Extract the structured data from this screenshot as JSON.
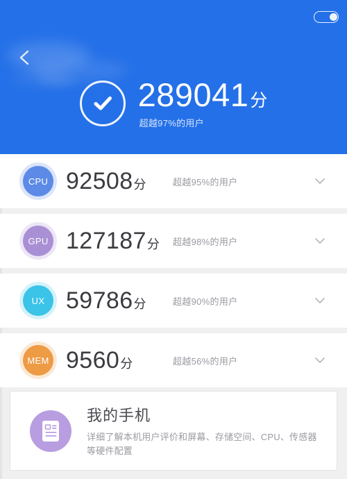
{
  "header": {
    "back_icon": "arrow-left-icon",
    "power_toggle_icon": "power-toggle-switch",
    "check_icon": "check-circle-icon",
    "total_score": "289041",
    "score_unit": "分",
    "score_subtitle": "超越97%的用户",
    "background_color": "#2470e8"
  },
  "metrics": [
    {
      "badge_label": "CPU",
      "badge_color": "#5c8ae6",
      "score": "92508",
      "unit": "分",
      "subtitle": "超越95%的用户",
      "chevron_icon": "chevron-down-icon"
    },
    {
      "badge_label": "GPU",
      "badge_color": "#a98fd4",
      "score": "127187",
      "unit": "分",
      "subtitle": "超越98%的用户",
      "chevron_icon": "chevron-down-icon"
    },
    {
      "badge_label": "UX",
      "badge_color": "#3bc3e8",
      "score": "59786",
      "unit": "分",
      "subtitle": "超越90%的用户",
      "chevron_icon": "chevron-down-icon"
    },
    {
      "badge_label": "MEM",
      "badge_color": "#ee9b45",
      "score": "9560",
      "unit": "分",
      "subtitle": "超越56%的用户",
      "chevron_icon": "chevron-down-icon"
    }
  ],
  "phone_card": {
    "icon": "document-list-icon",
    "icon_color": "#b89de0",
    "title": "我的手机",
    "description": "详细了解本机用户评价和屏幕、存储空间、CPU、传感器等硬件配置"
  }
}
